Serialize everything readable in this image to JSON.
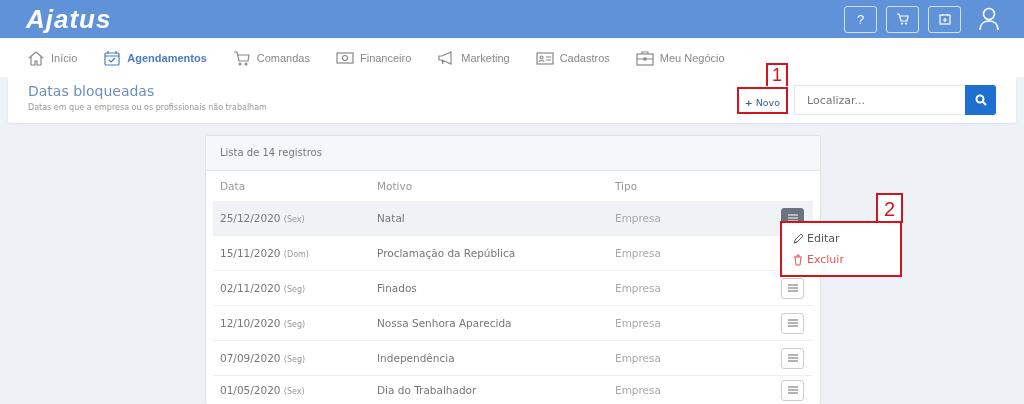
{
  "logo": "Ajatus",
  "header_buttons": [
    {
      "kind": "help",
      "label": "?"
    },
    {
      "kind": "cart"
    },
    {
      "kind": "calendar"
    }
  ],
  "nav": [
    {
      "label": "Início",
      "selected": false
    },
    {
      "label": "Agendamentos",
      "selected": true
    },
    {
      "label": "Comandas",
      "selected": false
    },
    {
      "label": "Financeiro",
      "selected": false
    },
    {
      "label": "Marketing",
      "selected": false
    },
    {
      "label": "Cadastros",
      "selected": false
    },
    {
      "label": "Meu Negócio",
      "selected": false
    }
  ],
  "page": {
    "title": "Datas bloqueadas",
    "subtitle": "Datas em que a empresa ou os profissionais não trabalham",
    "new_button": {
      "icon": "+",
      "label": "Novo",
      "callout": "1"
    },
    "search": {
      "placeholder": "Localizar..."
    }
  },
  "table": {
    "caption": "Lista de 14 registros",
    "columns": [
      "Data",
      "Motivo",
      "Tipo"
    ],
    "rows": [
      {
        "date": "25/12/2020",
        "weekday": "(Sex)",
        "reason": "Natal",
        "type": "Empresa",
        "selected": true,
        "menu_button": true
      },
      {
        "date": "15/11/2020",
        "weekday": "(Dom)",
        "reason": "Proclamação da República",
        "type": "Empresa",
        "selected": false,
        "menu_button": false
      },
      {
        "date": "02/11/2020",
        "weekday": "(Seg)",
        "reason": "Finados",
        "type": "Empresa",
        "selected": false,
        "menu_button": true
      },
      {
        "date": "12/10/2020",
        "weekday": "(Seg)",
        "reason": "Nossa Senhora Aparecida",
        "type": "Empresa",
        "selected": false,
        "menu_button": true
      },
      {
        "date": "07/09/2020",
        "weekday": "(Seg)",
        "reason": "Independência",
        "type": "Empresa",
        "selected": false,
        "menu_button": true
      },
      {
        "date": "01/05/2020",
        "weekday": "(Sex)",
        "reason": "Dia do Trabalhador",
        "type": "Empresa",
        "selected": false,
        "menu_button": true
      }
    ]
  },
  "row_menu": {
    "callout": "2",
    "items": [
      {
        "kind": "edit",
        "label": "Editar"
      },
      {
        "kind": "delete",
        "label": "Excluir"
      }
    ]
  }
}
